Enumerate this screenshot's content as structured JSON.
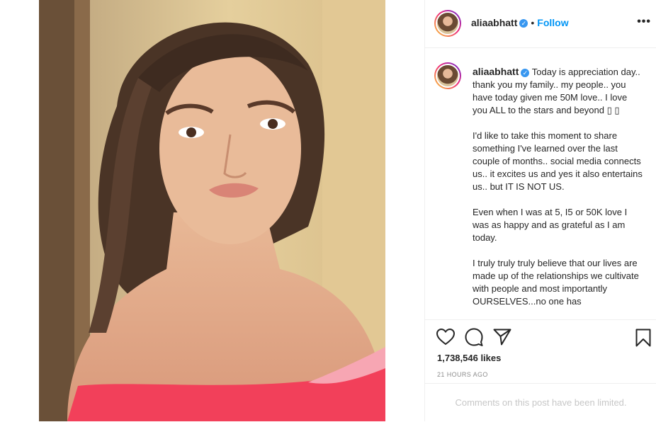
{
  "post": {
    "username": "aliaabhatt",
    "verified_mark": "✓",
    "separator": "•",
    "follow_label": "Follow",
    "more_label": "•••",
    "caption_username": "aliaabhatt",
    "caption_paragraphs": [
      "Today is appreciation day.. thank you my family.. my people.. you have today given me 50M love.. I love you ALL to the stars and beyond ▯ ▯",
      "I'd like to take this moment to share something I've learned over the last couple of months.. social media connects us.. it excites us and yes it also entertains us.. but IT IS NOT US.",
      "Even when I was at 5, I5 or 50K love I was as happy and as grateful as I am today.",
      "I truly truly truly believe that our lives are made up of the relationships we cultivate with people and most importantly OURSELVES...no one has"
    ],
    "likes": "1,738,546 likes",
    "timestamp": "21 HOURS AGO",
    "comments_notice": "Comments on this post have been limited.",
    "icons": {
      "like": "heart-icon",
      "comment": "comment-icon",
      "share": "share-icon",
      "save": "bookmark-icon"
    },
    "colors": {
      "accent": "#0095f6",
      "verified": "#3897f0",
      "muted": "#8e8e8e",
      "dress": "#f2405a"
    }
  }
}
